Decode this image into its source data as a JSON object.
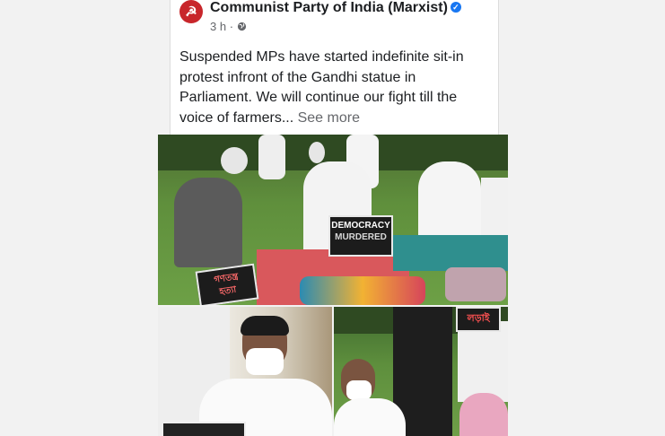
{
  "post": {
    "page_name": "Communist Party of India (Marxist)",
    "verified": true,
    "time": "3 h",
    "separator": "·",
    "privacy_icon": "globe-icon",
    "avatar_icon": "hammer-sickle-icon",
    "text": "Suspended MPs have started indefinite sit-in protest infront of the Gandhi statue in Parliament. We will continue our fight till the voice of farmers...",
    "see_more": "See more"
  },
  "photos": {
    "main_sign": {
      "line1": "DEMOCRACY",
      "line2": "MURDERED"
    },
    "main_sign_left": {
      "line1": "গণতন্ত্র",
      "line2": "হত্যা"
    },
    "right_sign": "লড়াই"
  },
  "colors": {
    "brand_red": "#c8262b",
    "verified_blue": "#1877f2",
    "muted_text": "#65676b"
  }
}
